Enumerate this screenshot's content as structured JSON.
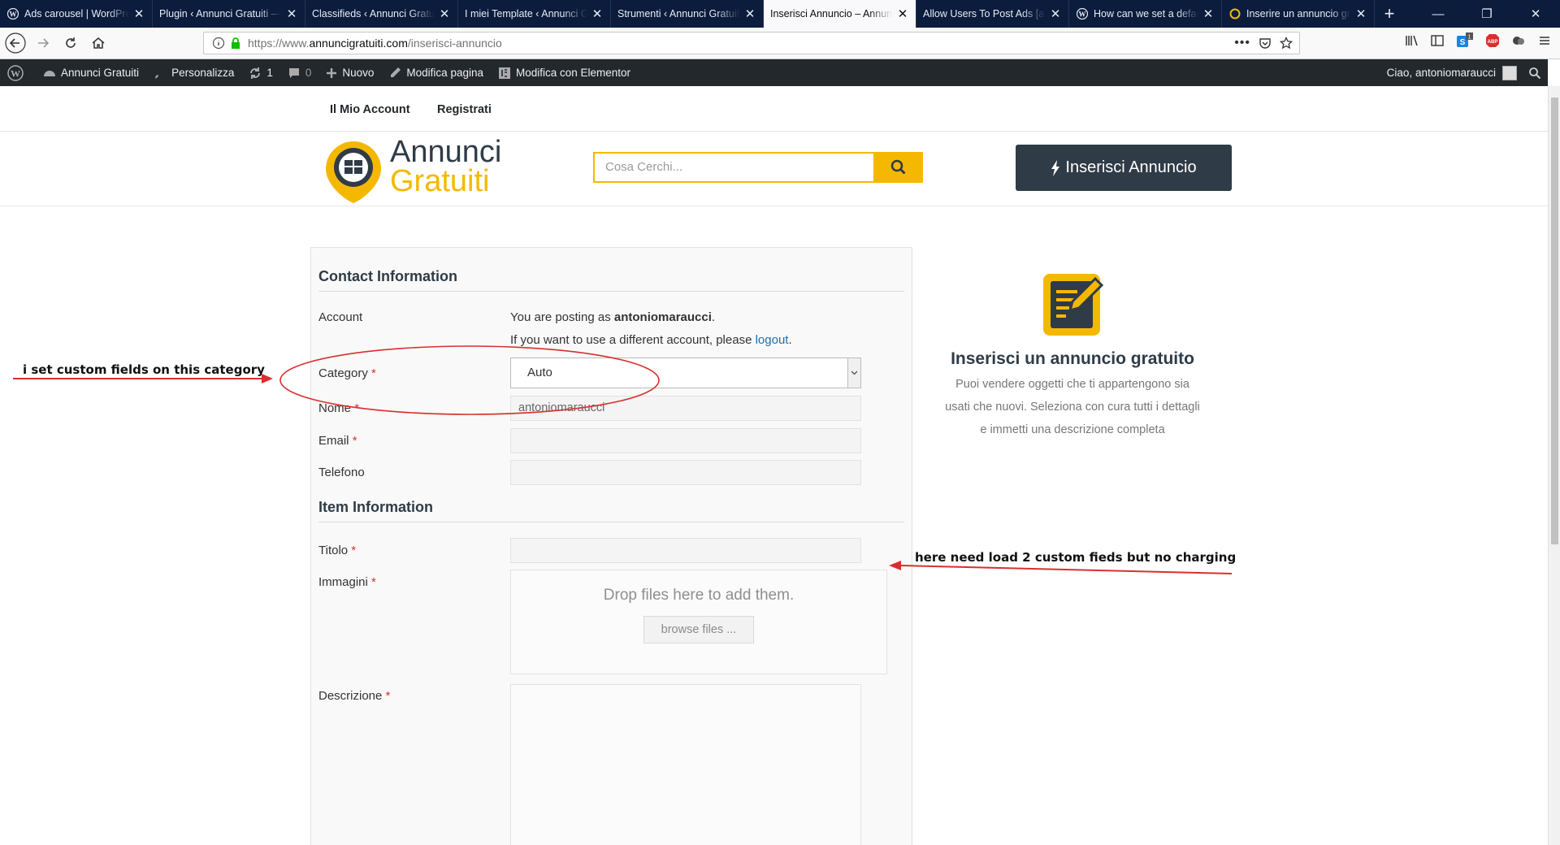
{
  "browser": {
    "tabs": [
      {
        "title": "Ads carousel | WordPress",
        "favicon": "wordpress-icon"
      },
      {
        "title": "Plugin ‹ Annunci Gratuiti — WordPress",
        "favicon": "none"
      },
      {
        "title": "Classifieds ‹ Annunci Gratuiti",
        "favicon": "none"
      },
      {
        "title": "I miei Template ‹ Annunci Gratuiti",
        "favicon": "none"
      },
      {
        "title": "Strumenti ‹ Annunci Gratuiti",
        "favicon": "none"
      },
      {
        "title": "Inserisci Annuncio – Annunci Gratuiti",
        "favicon": "none"
      },
      {
        "title": "Allow Users To Post Ads [adverts]",
        "favicon": "none"
      },
      {
        "title": "How can we set a default",
        "favicon": "wordpress-icon"
      },
      {
        "title": "Inserire un annuncio gratis",
        "favicon": "site-icon"
      }
    ],
    "active_tab_index": 5,
    "url_prefix": "https://www.",
    "url_host": "annuncigratuiti.com",
    "url_path": "/inserisci-annuncio",
    "new_tab_symbol": "+",
    "close_symbol": "✕"
  },
  "wp_admin_bar": {
    "site_name": "Annunci Gratuiti",
    "customize": "Personalizza",
    "updates_count": "1",
    "comments_count": "0",
    "new": "Nuovo",
    "edit_page": "Modifica pagina",
    "edit_elementor": "Modifica con Elementor",
    "greeting": "Ciao, antoniomaraucci"
  },
  "site": {
    "nav": [
      "Il Mio Account",
      "Registrati"
    ],
    "logo_line1": "Annunci",
    "logo_line2": "Gratuiti",
    "search_placeholder": "Cosa Cerchi...",
    "post_button": "Inserisci Annuncio",
    "brand_yellow": "#f5b800",
    "brand_dark": "#2f3b47"
  },
  "form": {
    "contact_title": "Contact Information",
    "account_label": "Account",
    "account_text_prefix": "You are posting as ",
    "account_user": "antoniomaraucci",
    "account_text_suffix": ".",
    "account_note_prefix": "If you want to use a different account, please ",
    "logout_link": "logout",
    "account_note_suffix": ".",
    "category_label": "Category",
    "category_value": "Auto",
    "nome_label": "Nome",
    "nome_value": "antoniomaraucci",
    "email_label": "Email",
    "email_value": "",
    "telefono_label": "Telefono",
    "telefono_value": "",
    "item_title": "Item Information",
    "titolo_label": "Titolo",
    "titolo_value": "",
    "immagini_label": "Immagini",
    "drop_message": "Drop files here to add them.",
    "browse_button": "browse files ...",
    "descrizione_label": "Descrizione",
    "required_mark": "*"
  },
  "sidebar": {
    "title": "Inserisci un annuncio gratuito",
    "description": "Puoi vendere oggetti che ti appartengono sia usati che nuovi. Seleziona con cura tutti i dettagli e immetti una descrizione completa"
  },
  "annotations": {
    "left_note": "i set custom fields on this category",
    "right_note": "here need load 2 custom fieds but no charging",
    "color": "#d9302f"
  }
}
